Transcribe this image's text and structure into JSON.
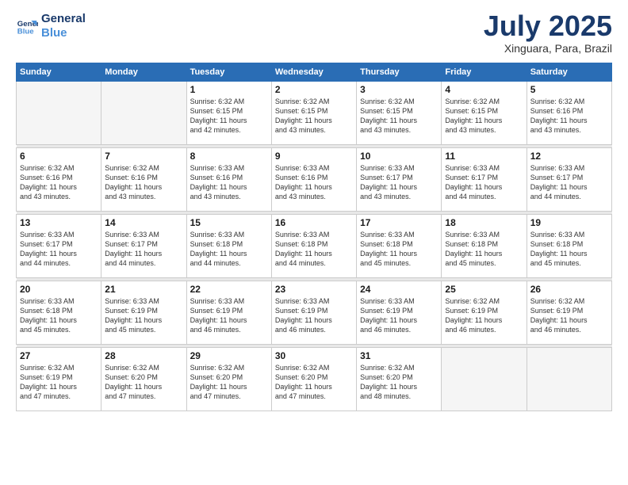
{
  "logo": {
    "line1": "General",
    "line2": "Blue"
  },
  "title": "July 2025",
  "location": "Xinguara, Para, Brazil",
  "days_header": [
    "Sunday",
    "Monday",
    "Tuesday",
    "Wednesday",
    "Thursday",
    "Friday",
    "Saturday"
  ],
  "weeks": [
    [
      {
        "day": "",
        "info": ""
      },
      {
        "day": "",
        "info": ""
      },
      {
        "day": "1",
        "info": "Sunrise: 6:32 AM\nSunset: 6:15 PM\nDaylight: 11 hours\nand 42 minutes."
      },
      {
        "day": "2",
        "info": "Sunrise: 6:32 AM\nSunset: 6:15 PM\nDaylight: 11 hours\nand 43 minutes."
      },
      {
        "day": "3",
        "info": "Sunrise: 6:32 AM\nSunset: 6:15 PM\nDaylight: 11 hours\nand 43 minutes."
      },
      {
        "day": "4",
        "info": "Sunrise: 6:32 AM\nSunset: 6:15 PM\nDaylight: 11 hours\nand 43 minutes."
      },
      {
        "day": "5",
        "info": "Sunrise: 6:32 AM\nSunset: 6:16 PM\nDaylight: 11 hours\nand 43 minutes."
      }
    ],
    [
      {
        "day": "6",
        "info": "Sunrise: 6:32 AM\nSunset: 6:16 PM\nDaylight: 11 hours\nand 43 minutes."
      },
      {
        "day": "7",
        "info": "Sunrise: 6:32 AM\nSunset: 6:16 PM\nDaylight: 11 hours\nand 43 minutes."
      },
      {
        "day": "8",
        "info": "Sunrise: 6:33 AM\nSunset: 6:16 PM\nDaylight: 11 hours\nand 43 minutes."
      },
      {
        "day": "9",
        "info": "Sunrise: 6:33 AM\nSunset: 6:16 PM\nDaylight: 11 hours\nand 43 minutes."
      },
      {
        "day": "10",
        "info": "Sunrise: 6:33 AM\nSunset: 6:17 PM\nDaylight: 11 hours\nand 43 minutes."
      },
      {
        "day": "11",
        "info": "Sunrise: 6:33 AM\nSunset: 6:17 PM\nDaylight: 11 hours\nand 44 minutes."
      },
      {
        "day": "12",
        "info": "Sunrise: 6:33 AM\nSunset: 6:17 PM\nDaylight: 11 hours\nand 44 minutes."
      }
    ],
    [
      {
        "day": "13",
        "info": "Sunrise: 6:33 AM\nSunset: 6:17 PM\nDaylight: 11 hours\nand 44 minutes."
      },
      {
        "day": "14",
        "info": "Sunrise: 6:33 AM\nSunset: 6:17 PM\nDaylight: 11 hours\nand 44 minutes."
      },
      {
        "day": "15",
        "info": "Sunrise: 6:33 AM\nSunset: 6:18 PM\nDaylight: 11 hours\nand 44 minutes."
      },
      {
        "day": "16",
        "info": "Sunrise: 6:33 AM\nSunset: 6:18 PM\nDaylight: 11 hours\nand 44 minutes."
      },
      {
        "day": "17",
        "info": "Sunrise: 6:33 AM\nSunset: 6:18 PM\nDaylight: 11 hours\nand 45 minutes."
      },
      {
        "day": "18",
        "info": "Sunrise: 6:33 AM\nSunset: 6:18 PM\nDaylight: 11 hours\nand 45 minutes."
      },
      {
        "day": "19",
        "info": "Sunrise: 6:33 AM\nSunset: 6:18 PM\nDaylight: 11 hours\nand 45 minutes."
      }
    ],
    [
      {
        "day": "20",
        "info": "Sunrise: 6:33 AM\nSunset: 6:18 PM\nDaylight: 11 hours\nand 45 minutes."
      },
      {
        "day": "21",
        "info": "Sunrise: 6:33 AM\nSunset: 6:19 PM\nDaylight: 11 hours\nand 45 minutes."
      },
      {
        "day": "22",
        "info": "Sunrise: 6:33 AM\nSunset: 6:19 PM\nDaylight: 11 hours\nand 46 minutes."
      },
      {
        "day": "23",
        "info": "Sunrise: 6:33 AM\nSunset: 6:19 PM\nDaylight: 11 hours\nand 46 minutes."
      },
      {
        "day": "24",
        "info": "Sunrise: 6:33 AM\nSunset: 6:19 PM\nDaylight: 11 hours\nand 46 minutes."
      },
      {
        "day": "25",
        "info": "Sunrise: 6:32 AM\nSunset: 6:19 PM\nDaylight: 11 hours\nand 46 minutes."
      },
      {
        "day": "26",
        "info": "Sunrise: 6:32 AM\nSunset: 6:19 PM\nDaylight: 11 hours\nand 46 minutes."
      }
    ],
    [
      {
        "day": "27",
        "info": "Sunrise: 6:32 AM\nSunset: 6:19 PM\nDaylight: 11 hours\nand 47 minutes."
      },
      {
        "day": "28",
        "info": "Sunrise: 6:32 AM\nSunset: 6:20 PM\nDaylight: 11 hours\nand 47 minutes."
      },
      {
        "day": "29",
        "info": "Sunrise: 6:32 AM\nSunset: 6:20 PM\nDaylight: 11 hours\nand 47 minutes."
      },
      {
        "day": "30",
        "info": "Sunrise: 6:32 AM\nSunset: 6:20 PM\nDaylight: 11 hours\nand 47 minutes."
      },
      {
        "day": "31",
        "info": "Sunrise: 6:32 AM\nSunset: 6:20 PM\nDaylight: 11 hours\nand 48 minutes."
      },
      {
        "day": "",
        "info": ""
      },
      {
        "day": "",
        "info": ""
      }
    ]
  ]
}
